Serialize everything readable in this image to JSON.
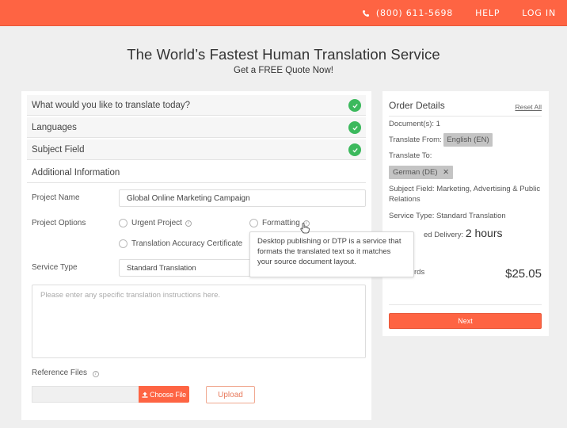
{
  "topbar": {
    "phone": "(800) 611-5698",
    "help": "HELP",
    "login": "LOG IN",
    "brand_color": "#fe6443"
  },
  "hero": {
    "title": "The World’s Fastest Human Translation Service",
    "subtitle": "Get a FREE Quote Now!"
  },
  "steps": [
    {
      "label": "What would you like to translate today?",
      "completed": true
    },
    {
      "label": "Languages",
      "completed": true
    },
    {
      "label": "Subject Field",
      "completed": true
    },
    {
      "label": "Additional Information",
      "completed": false
    }
  ],
  "form": {
    "project_name_label": "Project Name",
    "project_name_value": "Global Online Marketing Campaign",
    "project_options_label": "Project Options",
    "options": [
      {
        "label": "Urgent Project",
        "checked": false,
        "has_info": true
      },
      {
        "label": "Formatting",
        "checked": false,
        "has_info": true
      },
      {
        "label": "Translation Accuracy Certificate",
        "checked": false,
        "has_info": false
      }
    ],
    "service_type_label": "Service Type",
    "service_type_value": "Standard Translation",
    "instructions_placeholder": "Please enter any specific translation instructions here.",
    "reference_files_label": "Reference Files",
    "choose_file_label": "Choose File",
    "upload_label": "Upload"
  },
  "tooltip": {
    "text": "Desktop publishing or DTP is a service that formats the translated text so it matches your source document layout."
  },
  "order": {
    "title": "Order Details",
    "reset_label": "Reset All",
    "documents": "Document(s): 1",
    "translate_from_label": "Translate From:",
    "translate_from_value": "English (EN)",
    "translate_to_label": "Translate To:",
    "translate_to_value": "German (DE)",
    "subject_field": "Subject Field: Marketing, Advertising & Public Relations",
    "service_type": "Service Type:  Standard Translation",
    "delivery_label": "ed Delivery:",
    "delivery_value": "2 hours",
    "words_label": "rds",
    "price": "$25.05",
    "next_label": "Next"
  }
}
